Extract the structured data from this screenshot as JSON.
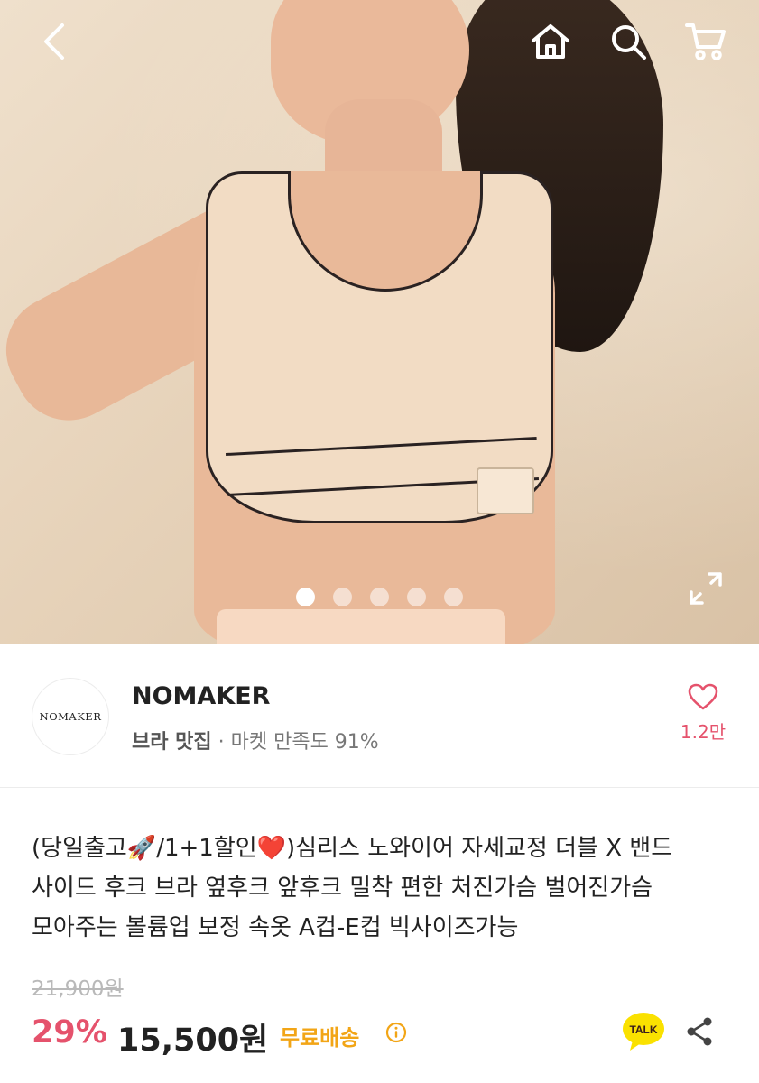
{
  "hero": {
    "carousel_total": 5,
    "carousel_active": 1
  },
  "seller": {
    "logo_text": "NOMAKER",
    "name": "NOMAKER",
    "category": "브라 맛집",
    "separator": "·",
    "satisfaction": "마켓 만족도 91%",
    "likes": "1.2만"
  },
  "product": {
    "title": "(당일출고🚀/1+1할인❤️)심리스 노와이어 자세교정 더블 X 밴드 사이드 후크 브라 옆후크 앞후크 밀착 편한 처진가슴 벌어진가슴 모아주는 볼륨업 보정 속옷 A컵-E컵 빅사이즈가능",
    "original_price": "21,900원",
    "discount": "29%",
    "price": "15,500원",
    "shipping": "무료배송",
    "talk_label": "TALK"
  },
  "colors": {
    "accent_pink": "#e5526c",
    "shipping_orange": "#f2a516",
    "talk_yellow": "#fae100"
  },
  "icons": [
    "back-icon",
    "home-icon",
    "search-icon",
    "cart-icon",
    "expand-icon",
    "heart-icon",
    "info-icon",
    "kakao-talk-icon",
    "share-icon"
  ]
}
